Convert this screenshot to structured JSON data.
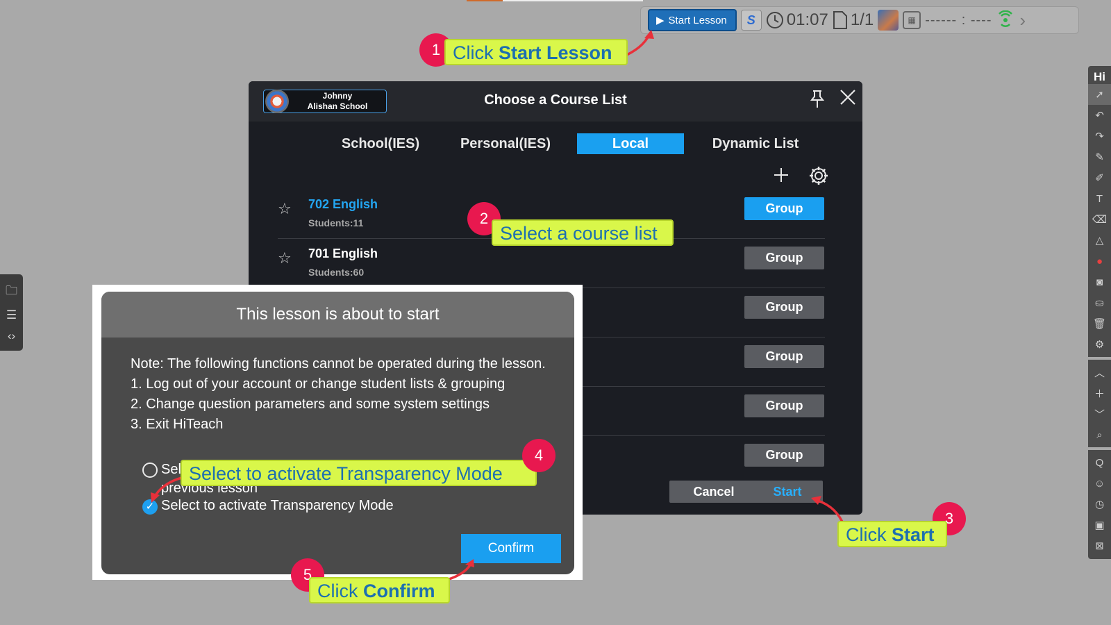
{
  "toolbar": {
    "start_lesson_label": "Start Lesson",
    "timer": "01:07",
    "page_indicator": "1/1",
    "connection_code": "------ : ----",
    "icons": [
      "play-icon",
      "sync-icon",
      "clock-icon",
      "page-icon",
      "avatar",
      "qr-icon",
      "signal-icon",
      "chevron-right-icon"
    ]
  },
  "right_toolbar": {
    "brand": "Hi"
  },
  "course_dialog": {
    "school_name": "Johnny",
    "school_sub": "Alishan School",
    "title": "Choose a Course List",
    "tabs": [
      {
        "label": "School(IES)",
        "active": false
      },
      {
        "label": "Personal(IES)",
        "active": false
      },
      {
        "label": "Local",
        "active": true
      },
      {
        "label": "Dynamic List",
        "active": false
      }
    ],
    "courses": [
      {
        "name": "702 English",
        "students": "Students:11",
        "selected": true,
        "group_label": "Group"
      },
      {
        "name": "701 English",
        "students": "Students:60",
        "selected": false,
        "group_label": "Group"
      },
      {
        "name": "",
        "students": "",
        "selected": false,
        "group_label": "Group"
      },
      {
        "name": "",
        "students": "",
        "selected": false,
        "group_label": "Group"
      },
      {
        "name": "",
        "students": "",
        "selected": false,
        "group_label": "Group"
      },
      {
        "name": "",
        "students": "",
        "selected": false,
        "group_label": "Group"
      }
    ],
    "cancel_label": "Cancel",
    "start_label": "Start"
  },
  "lesson_dialog": {
    "title": "This lesson is about to start",
    "note_line1": "Note: The following functions cannot be operated during the lesson.",
    "item1": "1. Log out of your account or change student lists & grouping",
    "item2": "2. Change question parameters and some system settings",
    "item3": "3. Exit HiTeach",
    "radio_label_start": "Sel",
    "radio_label_end": "previous lesson",
    "checkbox_label": "Select to activate Transparency Mode",
    "confirm_label": "Confirm"
  },
  "callouts": {
    "c1": {
      "number": "1",
      "prefix": "Click ",
      "bold": "Start Lesson"
    },
    "c2": {
      "number": "2",
      "text": "Select a course list"
    },
    "c3": {
      "number": "3",
      "prefix": "Click ",
      "bold": "Start"
    },
    "c4": {
      "number": "4",
      "text": "Select to activate Transparency Mode"
    },
    "c5": {
      "number": "5",
      "prefix": "Click ",
      "bold": "Confirm"
    }
  },
  "colors": {
    "accent_blue": "#1a9ff0",
    "callout_bg": "#d9f74a",
    "callout_text": "#1d6fb0",
    "badge_red": "#e8184f",
    "arrow_red": "#e8303a"
  }
}
